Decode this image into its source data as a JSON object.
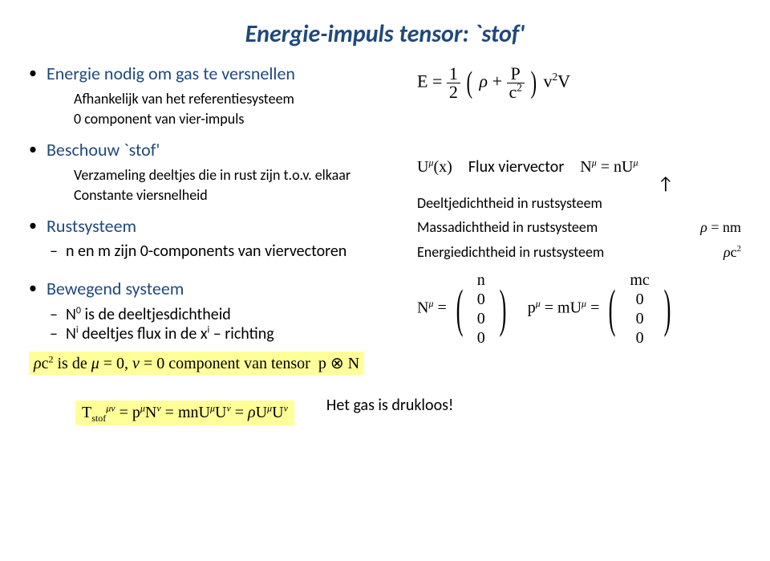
{
  "title": "Energie-impuls tensor: `stof'",
  "left": {
    "b1": "Energie nodig om gas te versnellen",
    "b1s1": "Afhankelijk van het referentiesysteem",
    "b1s2": "0 component van vier-impuls",
    "b2": "Beschouw `stof'",
    "b2s1": "Verzameling deeltjes die in rust zijn t.o.v. elkaar",
    "b2s2": "Constante viersnelheid",
    "b3": "Rustsysteem",
    "b3d1": "n en m zijn 0-components van viervectoren",
    "b4": "Bewegend systeem",
    "b4d1": "N⁰ is de deeltjesdichtheid",
    "b4d2": "Nⁱ deeltjes flux in de xⁱ – richting",
    "yellow1_pre": "ρc² is de ",
    "yellow1_mid": "μ = 0, ν = 0",
    "yellow1_post": " component van tensor   p ⊗ N"
  },
  "right": {
    "E_eq": "E = ½ (ρ + P/c²) v² V",
    "Ux": "Uᵘ(x)",
    "flux_label": "Flux viervector",
    "N_eq": "Nᵘ = nUᵘ",
    "r1": "Deeltjedichtheid in rustsysteem",
    "r2": "Massadichtheid in rustsysteem",
    "r2eq": "ρ = nm",
    "r3": "Energiedichtheid in rustsysteem",
    "r3eq": "ρc²"
  },
  "bottom": {
    "T_eq": "Tᵘᵛ_stof = pᵘNᵛ = mnUᵘUᵛ = ρUᵘUᵛ",
    "gas": "Het gas is drukloos!"
  }
}
